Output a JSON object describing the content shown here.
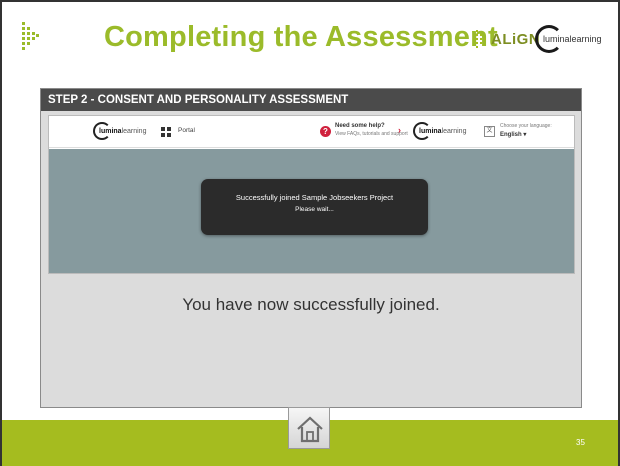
{
  "header": {
    "title": "Completing the Assessment",
    "align_logo_text": "ALiGN",
    "lumina_logo_text": "luminalearning"
  },
  "step_bar": {
    "label": "STEP 2 - CONSENT AND PERSONALITY ASSESSMENT"
  },
  "browser": {
    "nav": {
      "logo_text_bold": "lumina",
      "logo_text": "learning",
      "portal_label": "Portal",
      "help_title": "Need some help?",
      "help_subtitle": "View FAQs, tutorials and support",
      "language_label": "Choose your language:",
      "language_value": "English ▾"
    },
    "toast": {
      "message": "Successfully joined Sample Jobseekers Project",
      "wait": "Please wait..."
    }
  },
  "caption": "You have now successfully joined.",
  "footer": {
    "page_number": "35"
  },
  "colors": {
    "title_green": "#9bbb2a",
    "footer_green": "#a5bc1f",
    "step_bar_bg": "#4b4b4b",
    "overlay_bg": "#869a9e",
    "toast_bg": "#2b2b2b",
    "help_red": "#d0213d"
  }
}
